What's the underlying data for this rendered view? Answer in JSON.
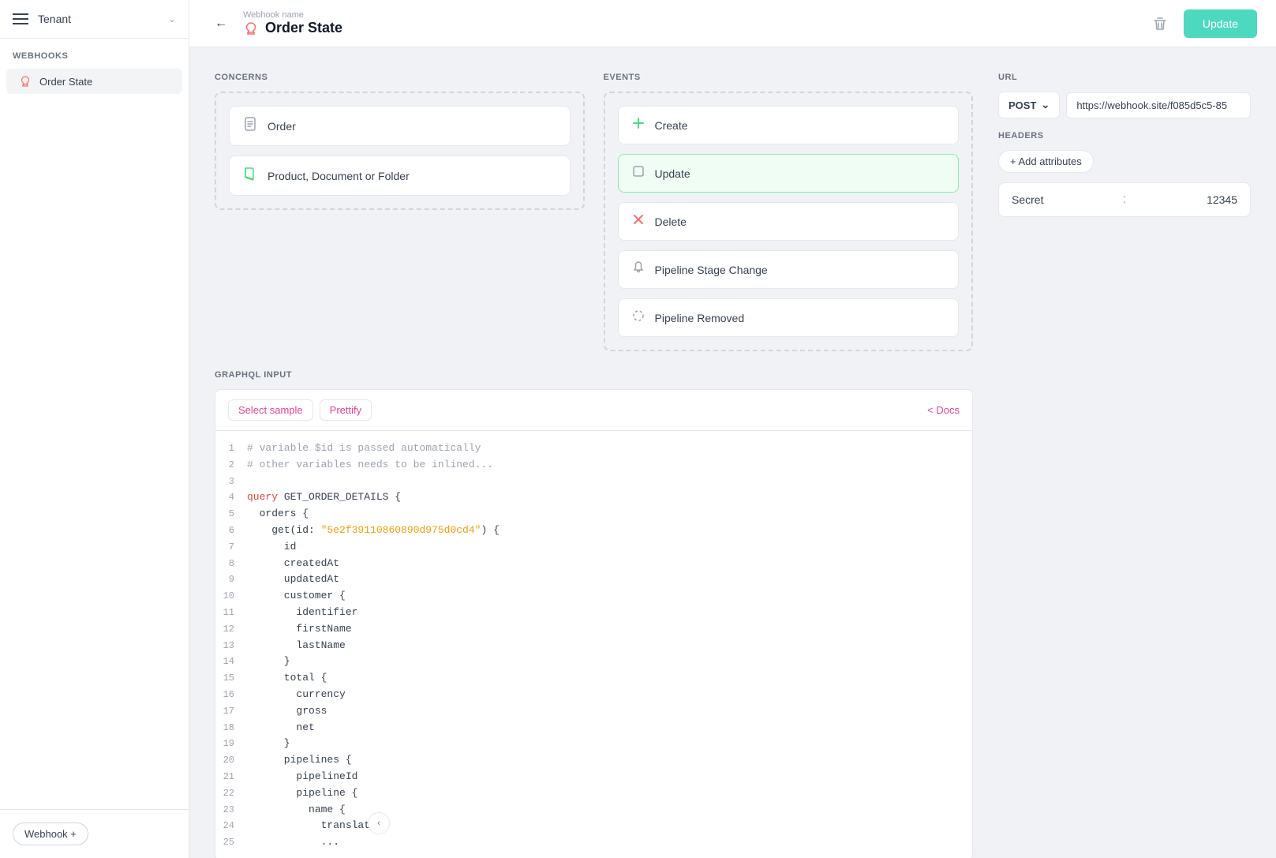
{
  "sidebar": {
    "tenant_name": "Tenant",
    "section_title": "Webhooks",
    "items": [
      {
        "label": "Order State",
        "active": true
      }
    ],
    "add_button": "Webhook +"
  },
  "topbar": {
    "webhook_name_hint": "Webhook name",
    "webhook_name": "Order State",
    "update_button": "Update"
  },
  "concerns": {
    "section_title": "CONCERNS",
    "items": [
      {
        "label": "Order",
        "icon": "document"
      },
      {
        "label": "Product, Document or Folder",
        "icon": "book"
      }
    ]
  },
  "events": {
    "section_title": "EVENTS",
    "items": [
      {
        "label": "Create",
        "icon": "plus",
        "selected": false
      },
      {
        "label": "Update",
        "icon": "square",
        "selected": true
      },
      {
        "label": "Delete",
        "icon": "x",
        "selected": false
      },
      {
        "label": "Pipeline Stage Change",
        "icon": "bell",
        "selected": false
      },
      {
        "label": "Pipeline Removed",
        "icon": "dashed-circle",
        "selected": false
      }
    ]
  },
  "url": {
    "section_title": "URL",
    "method": "POST",
    "value": "https://webhook.site/f085d5c5-85"
  },
  "headers": {
    "section_title": "HEADERS",
    "add_button": "+ Add attributes",
    "rows": [
      {
        "key": "Secret",
        "separator": ":",
        "value": "12345"
      }
    ]
  },
  "graphql": {
    "section_title": "GRAPHQL INPUT",
    "select_sample_label": "Select sample",
    "prettify_label": "Prettify",
    "docs_label": "< Docs",
    "lines": [
      {
        "num": 1,
        "parts": [
          {
            "type": "comment",
            "text": "# variable $id is passed automatically"
          }
        ]
      },
      {
        "num": 2,
        "parts": [
          {
            "type": "comment",
            "text": "# other variables needs to be inlined..."
          }
        ]
      },
      {
        "num": 3,
        "parts": [
          {
            "type": "plain",
            "text": ""
          }
        ]
      },
      {
        "num": 4,
        "parts": [
          {
            "type": "keyword",
            "text": "query"
          },
          {
            "type": "plain",
            "text": " GET_ORDER_DETAILS {"
          },
          {
            "type": "arrow",
            "text": "▼"
          }
        ]
      },
      {
        "num": 5,
        "parts": [
          {
            "type": "plain",
            "text": "  orders {"
          },
          {
            "type": "arrow",
            "text": "▼"
          }
        ]
      },
      {
        "num": 6,
        "parts": [
          {
            "type": "plain",
            "text": "    get(id: "
          },
          {
            "type": "string",
            "text": "\"5e2f39110860890d975d0cd4\""
          },
          {
            "type": "plain",
            "text": ") {"
          },
          {
            "type": "arrow",
            "text": "▼"
          }
        ]
      },
      {
        "num": 7,
        "parts": [
          {
            "type": "plain",
            "text": "      id"
          }
        ]
      },
      {
        "num": 8,
        "parts": [
          {
            "type": "plain",
            "text": "      createdAt"
          }
        ]
      },
      {
        "num": 9,
        "parts": [
          {
            "type": "plain",
            "text": "      updatedAt"
          }
        ]
      },
      {
        "num": 10,
        "parts": [
          {
            "type": "plain",
            "text": "      customer {"
          },
          {
            "type": "arrow",
            "text": "▼"
          }
        ]
      },
      {
        "num": 11,
        "parts": [
          {
            "type": "plain",
            "text": "        identifier"
          }
        ]
      },
      {
        "num": 12,
        "parts": [
          {
            "type": "plain",
            "text": "        firstName"
          }
        ]
      },
      {
        "num": 13,
        "parts": [
          {
            "type": "plain",
            "text": "        lastName"
          }
        ]
      },
      {
        "num": 14,
        "parts": [
          {
            "type": "plain",
            "text": "      }"
          }
        ]
      },
      {
        "num": 15,
        "parts": [
          {
            "type": "plain",
            "text": "      total {"
          },
          {
            "type": "arrow",
            "text": "▼"
          }
        ]
      },
      {
        "num": 16,
        "parts": [
          {
            "type": "plain",
            "text": "        currency"
          }
        ]
      },
      {
        "num": 17,
        "parts": [
          {
            "type": "plain",
            "text": "        gross"
          }
        ]
      },
      {
        "num": 18,
        "parts": [
          {
            "type": "plain",
            "text": "        net"
          }
        ]
      },
      {
        "num": 19,
        "parts": [
          {
            "type": "plain",
            "text": "      }"
          }
        ]
      },
      {
        "num": 20,
        "parts": [
          {
            "type": "plain",
            "text": "      pipelines {"
          },
          {
            "type": "arrow",
            "text": "▼"
          }
        ]
      },
      {
        "num": 21,
        "parts": [
          {
            "type": "plain",
            "text": "        pipelineId"
          }
        ]
      },
      {
        "num": 22,
        "parts": [
          {
            "type": "plain",
            "text": "        pipeline {"
          },
          {
            "type": "arrow",
            "text": "▼"
          }
        ]
      },
      {
        "num": 23,
        "parts": [
          {
            "type": "plain",
            "text": "          name {"
          }
        ]
      },
      {
        "num": 24,
        "parts": [
          {
            "type": "plain",
            "text": "            translation"
          }
        ]
      },
      {
        "num": 25,
        "parts": [
          {
            "type": "plain",
            "text": "            ..."
          }
        ]
      }
    ]
  }
}
